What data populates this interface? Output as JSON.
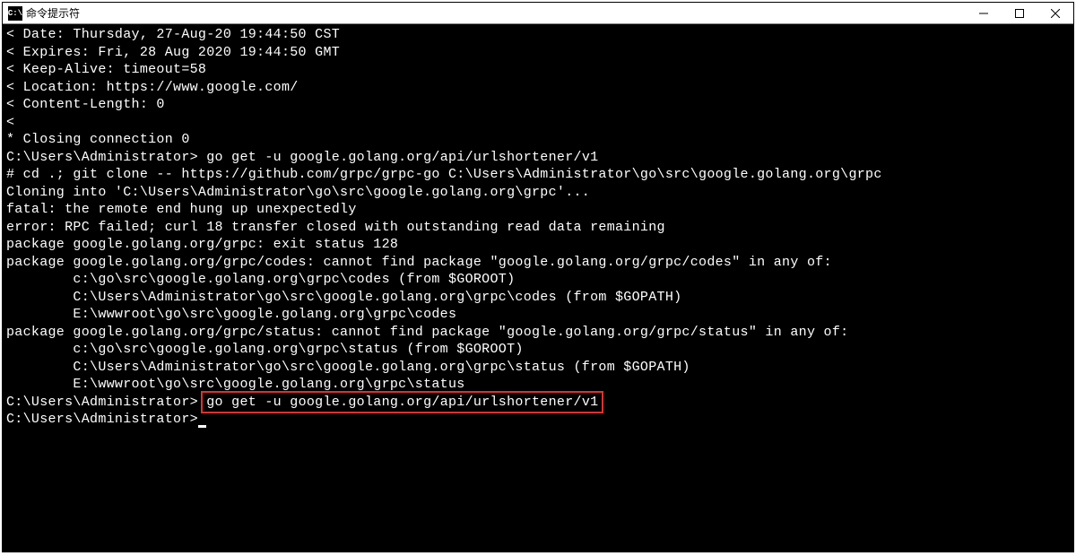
{
  "window": {
    "title": "命令提示符",
    "icon_label": "C:\\"
  },
  "terminal": {
    "lines": {
      "l1": "< Date: Thursday, 27-Aug-20 19:44:50 CST",
      "l2": "< Expires: Fri, 28 Aug 2020 19:44:50 GMT",
      "l3": "< Keep-Alive: timeout=58",
      "l4": "< Location: https://www.google.com/",
      "l5": "< Content-Length: 0",
      "l6": "<",
      "l7": "* Closing connection 0",
      "l8": "",
      "l9_prompt": "C:\\Users\\Administrator> ",
      "l9_cmd": "go get -u google.golang.org/api/urlshortener/v1",
      "l10": "# cd .; git clone -- https://github.com/grpc/grpc-go C:\\Users\\Administrator\\go\\src\\google.golang.org\\grpc",
      "l11": "Cloning into 'C:\\Users\\Administrator\\go\\src\\google.golang.org\\grpc'...",
      "l12": "fatal: the remote end hung up unexpectedly",
      "l13": "error: RPC failed; curl 18 transfer closed with outstanding read data remaining",
      "l14": "package google.golang.org/grpc: exit status 128",
      "l15": "package google.golang.org/grpc/codes: cannot find package \"google.golang.org/grpc/codes\" in any of:",
      "l16": "        c:\\go\\src\\google.golang.org\\grpc\\codes (from $GOROOT)",
      "l17": "        C:\\Users\\Administrator\\go\\src\\google.golang.org\\grpc\\codes (from $GOPATH)",
      "l18": "        E:\\wwwroot\\go\\src\\google.golang.org\\grpc\\codes",
      "l19": "package google.golang.org/grpc/status: cannot find package \"google.golang.org/grpc/status\" in any of:",
      "l20": "        c:\\go\\src\\google.golang.org\\grpc\\status (from $GOROOT)",
      "l21": "        C:\\Users\\Administrator\\go\\src\\google.golang.org\\grpc\\status (from $GOPATH)",
      "l22": "        E:\\wwwroot\\go\\src\\google.golang.org\\grpc\\status",
      "l23": "",
      "l24_prompt": "C:\\Users\\Administrator> ",
      "l24_cmd": "go get -u google.golang.org/api/urlshortener/v1",
      "l25": "",
      "l26_prompt": "C:\\Users\\Administrator>"
    }
  }
}
